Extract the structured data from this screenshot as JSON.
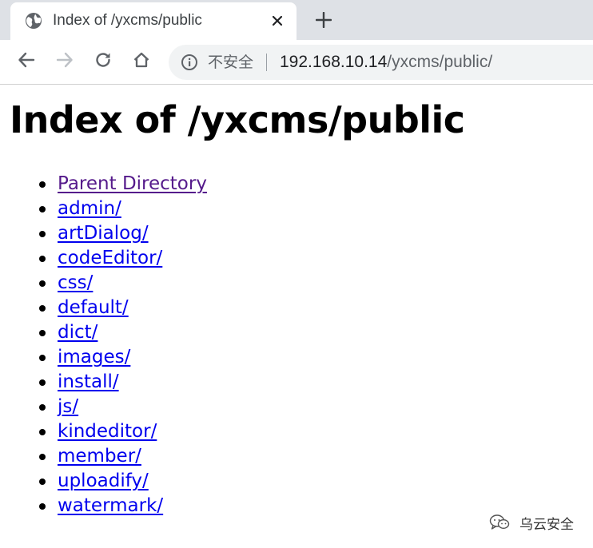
{
  "browser": {
    "tab": {
      "title": "Index of /yxcms/public",
      "favicon": "globe-icon",
      "close_icon": "close-icon"
    },
    "new_tab_icon": "plus-icon",
    "toolbar": {
      "back_icon": "arrow-left-icon",
      "forward_icon": "arrow-right-icon",
      "reload_icon": "reload-icon",
      "home_icon": "home-icon"
    },
    "omnibox": {
      "info_icon": "info-icon",
      "security_label": "不安全",
      "url_host": "192.168.10.14",
      "url_path": "/yxcms/public/"
    }
  },
  "page": {
    "heading": "Index of /yxcms/public",
    "entries": [
      {
        "label": "Parent Directory",
        "visited": true
      },
      {
        "label": "admin/",
        "visited": false
      },
      {
        "label": "artDialog/",
        "visited": false
      },
      {
        "label": "codeEditor/",
        "visited": false
      },
      {
        "label": "css/",
        "visited": false
      },
      {
        "label": "default/",
        "visited": false
      },
      {
        "label": "dict/",
        "visited": false
      },
      {
        "label": "images/",
        "visited": false
      },
      {
        "label": "install/",
        "visited": false
      },
      {
        "label": "js/",
        "visited": false
      },
      {
        "label": "kindeditor/",
        "visited": false
      },
      {
        "label": "member/",
        "visited": false
      },
      {
        "label": "uploadify/",
        "visited": false
      },
      {
        "label": "watermark/",
        "visited": false
      }
    ]
  },
  "watermark": {
    "icon": "wechat-icon",
    "text": "乌云安全"
  },
  "colors": {
    "link": "#0000ee",
    "visited_link": "#551a8b",
    "tabstrip_bg": "#dee1e6",
    "omnibox_bg": "#f1f3f4"
  }
}
